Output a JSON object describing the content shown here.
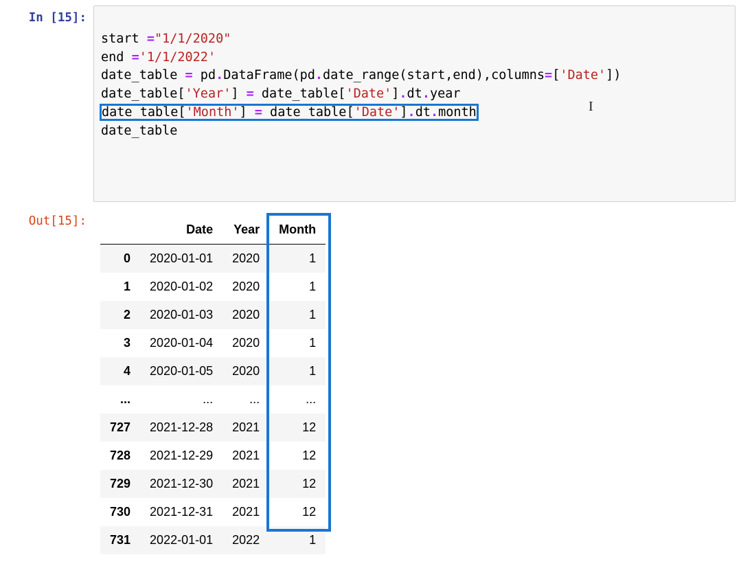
{
  "prompts": {
    "in_label": "In [15]:",
    "out_label": "Out[15]:"
  },
  "code": {
    "l1_a": "start ",
    "l1_eq": "=",
    "l1_str": "\"1/1/2020\"",
    "l2_a": "end ",
    "l2_eq": "=",
    "l2_str": "'1/1/2022'",
    "l3_a": "date_table ",
    "l3_eq": "=",
    "l3_b": " pd",
    "l3_dot1": ".",
    "l3_c": "DataFrame(pd",
    "l3_dot2": ".",
    "l3_d": "date_range(start,end),columns",
    "l3_eq2": "=",
    "l3_e": "[",
    "l3_str": "'Date'",
    "l3_f": "])",
    "l4_a": "date_table[",
    "l4_str1": "'Year'",
    "l4_b": "] ",
    "l4_eq": "=",
    "l4_c": " date_table[",
    "l4_str2": "'Date'",
    "l4_d": "]",
    "l4_dot": ".",
    "l4_e": "dt",
    "l4_dot2": ".",
    "l4_f": "year",
    "l5_a": "date_table[",
    "l5_str1": "'Month'",
    "l5_b": "] ",
    "l5_eq": "=",
    "l5_c": " date_table[",
    "l5_str2": "'Date'",
    "l5_d": "]",
    "l5_dot": ".",
    "l5_e": "dt",
    "l5_dot2": ".",
    "l5_f": "month",
    "l6": "date_table"
  },
  "table": {
    "columns": [
      "",
      "Date",
      "Year",
      "Month"
    ],
    "rows": [
      {
        "idx": "0",
        "date": "2020-01-01",
        "year": "2020",
        "month": "1"
      },
      {
        "idx": "1",
        "date": "2020-01-02",
        "year": "2020",
        "month": "1"
      },
      {
        "idx": "2",
        "date": "2020-01-03",
        "year": "2020",
        "month": "1"
      },
      {
        "idx": "3",
        "date": "2020-01-04",
        "year": "2020",
        "month": "1"
      },
      {
        "idx": "4",
        "date": "2020-01-05",
        "year": "2020",
        "month": "1"
      },
      {
        "idx": "...",
        "date": "...",
        "year": "...",
        "month": "..."
      },
      {
        "idx": "727",
        "date": "2021-12-28",
        "year": "2021",
        "month": "12"
      },
      {
        "idx": "728",
        "date": "2021-12-29",
        "year": "2021",
        "month": "12"
      },
      {
        "idx": "729",
        "date": "2021-12-30",
        "year": "2021",
        "month": "12"
      },
      {
        "idx": "730",
        "date": "2021-12-31",
        "year": "2021",
        "month": "12"
      },
      {
        "idx": "731",
        "date": "2022-01-01",
        "year": "2022",
        "month": "1"
      }
    ]
  },
  "cursor": "I"
}
